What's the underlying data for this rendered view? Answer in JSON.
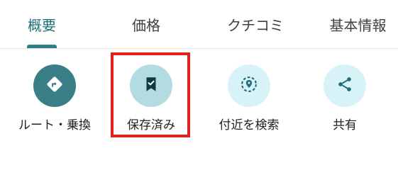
{
  "tabs": [
    {
      "label": "概要",
      "active": true
    },
    {
      "label": "価格",
      "active": false
    },
    {
      "label": "クチコミ",
      "active": false
    },
    {
      "label": "基本情報",
      "active": false
    }
  ],
  "actions": [
    {
      "label": "ルート・乗換",
      "icon": "directions-icon",
      "circle_color": "#3a7f87",
      "icon_color": "#ffffff"
    },
    {
      "label": "保存済み",
      "icon": "bookmark-saved-icon",
      "circle_color": "#b3dce2",
      "icon_color": "#0d3b40"
    },
    {
      "label": "付近を検索",
      "icon": "nearby-search-icon",
      "circle_color": "#d8f3f7",
      "icon_color": "#1f6f78"
    },
    {
      "label": "共有",
      "icon": "share-icon",
      "circle_color": "#d8f3f7",
      "icon_color": "#1f6f78"
    }
  ],
  "colors": {
    "accent": "#2f7f88",
    "highlight": "#e0211c"
  }
}
